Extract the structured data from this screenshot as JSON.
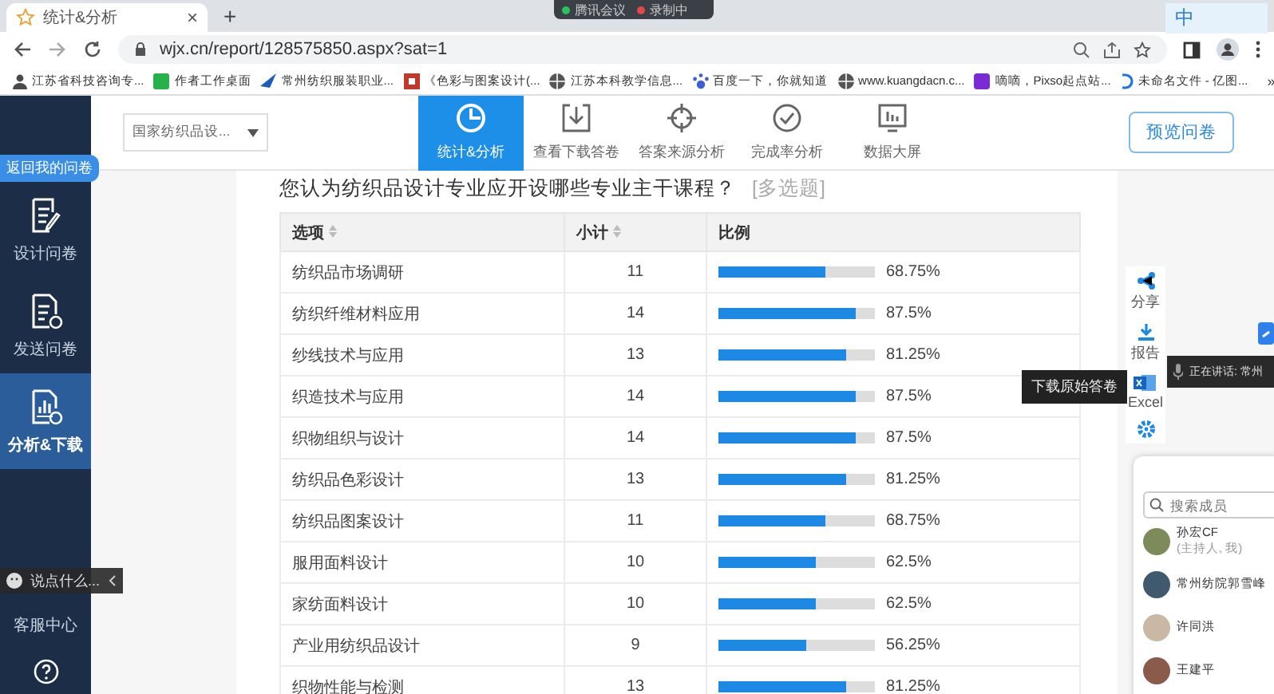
{
  "browser": {
    "tab_title": "统计&分析",
    "close": "×",
    "new_tab": "+",
    "url": "wjx.cn/report/128575850.aspx?sat=1",
    "bookmarks": [
      "江苏省科技咨询专...",
      "作者工作桌面",
      "常州纺织服装职业...",
      "《色彩与图案设计(...",
      "江苏本科教学信息...",
      "百度一下，你就知道",
      "www.kuangdacn.c...",
      "嘀嘀，Pixso起点站...",
      "未命名文件 - 亿图..."
    ],
    "overflow": "»"
  },
  "meeting_bar": {
    "app": "腾讯会议",
    "recording": "录制中"
  },
  "ime": {
    "label": "中"
  },
  "sidebar": {
    "back_badge": "返回我的问卷",
    "items": [
      {
        "label": "设计问卷",
        "selected": false
      },
      {
        "label": "发送问卷",
        "selected": false
      },
      {
        "label": "分析&下载",
        "selected": true
      }
    ],
    "chat_placeholder": "说点什么...",
    "service": "客服中心"
  },
  "header": {
    "survey_select": "国家纺织品设...",
    "tabs": [
      {
        "label": "统计&分析",
        "selected": true
      },
      {
        "label": "查看下载答卷",
        "selected": false
      },
      {
        "label": "答案来源分析",
        "selected": false
      },
      {
        "label": "完成率分析",
        "selected": false
      },
      {
        "label": "数据大屏",
        "selected": false
      }
    ],
    "preview_button": "预览问卷"
  },
  "question": {
    "title": "您认为纺织品设计专业应开设哪些专业主干课程？",
    "type": "[多选题]"
  },
  "table": {
    "columns": [
      {
        "label": "选项",
        "sortable": true
      },
      {
        "label": "小计",
        "sortable": true
      },
      {
        "label": "比例",
        "sortable": false
      }
    ],
    "rows": [
      {
        "option": "纺织品市场调研",
        "count": "11",
        "percent": "68.75%",
        "level": 0.6875
      },
      {
        "option": "纺织纤维材料应用",
        "count": "14",
        "percent": "87.5%",
        "level": 0.875
      },
      {
        "option": "纱线技术与应用",
        "count": "13",
        "percent": "81.25%",
        "level": 0.8125
      },
      {
        "option": "织造技术与应用",
        "count": "14",
        "percent": "87.5%",
        "level": 0.875
      },
      {
        "option": "织物组织与设计",
        "count": "14",
        "percent": "87.5%",
        "level": 0.875
      },
      {
        "option": "纺织品色彩设计",
        "count": "13",
        "percent": "81.25%",
        "level": 0.8125
      },
      {
        "option": "纺织品图案设计",
        "count": "11",
        "percent": "68.75%",
        "level": 0.6875
      },
      {
        "option": "服用面料设计",
        "count": "10",
        "percent": "62.5%",
        "level": 0.625
      },
      {
        "option": "家纺面料设计",
        "count": "10",
        "percent": "62.5%",
        "level": 0.625
      },
      {
        "option": "产业用纺织品设计",
        "count": "9",
        "percent": "56.25%",
        "level": 0.5625
      },
      {
        "option": "织物性能与检测",
        "count": "13",
        "percent": "81.25%",
        "level": 0.8125
      }
    ]
  },
  "side_tools": [
    {
      "label": "分享"
    },
    {
      "label": "报告"
    },
    {
      "label": "Excel"
    }
  ],
  "tooltip": "下载原始答卷",
  "speaking": "正在讲话: 常州",
  "members": {
    "placeholder": "搜索成员",
    "list": [
      {
        "name": "孙宏CF",
        "role": "(主持人, 我)",
        "color": "#7d8a5a"
      },
      {
        "name": "常州纺院郭雪峰",
        "color": "#3f5a6e"
      },
      {
        "name": "许同洪",
        "color": "#c9b8a4"
      },
      {
        "name": "王建平",
        "color": "#8a5a4a"
      }
    ]
  }
}
